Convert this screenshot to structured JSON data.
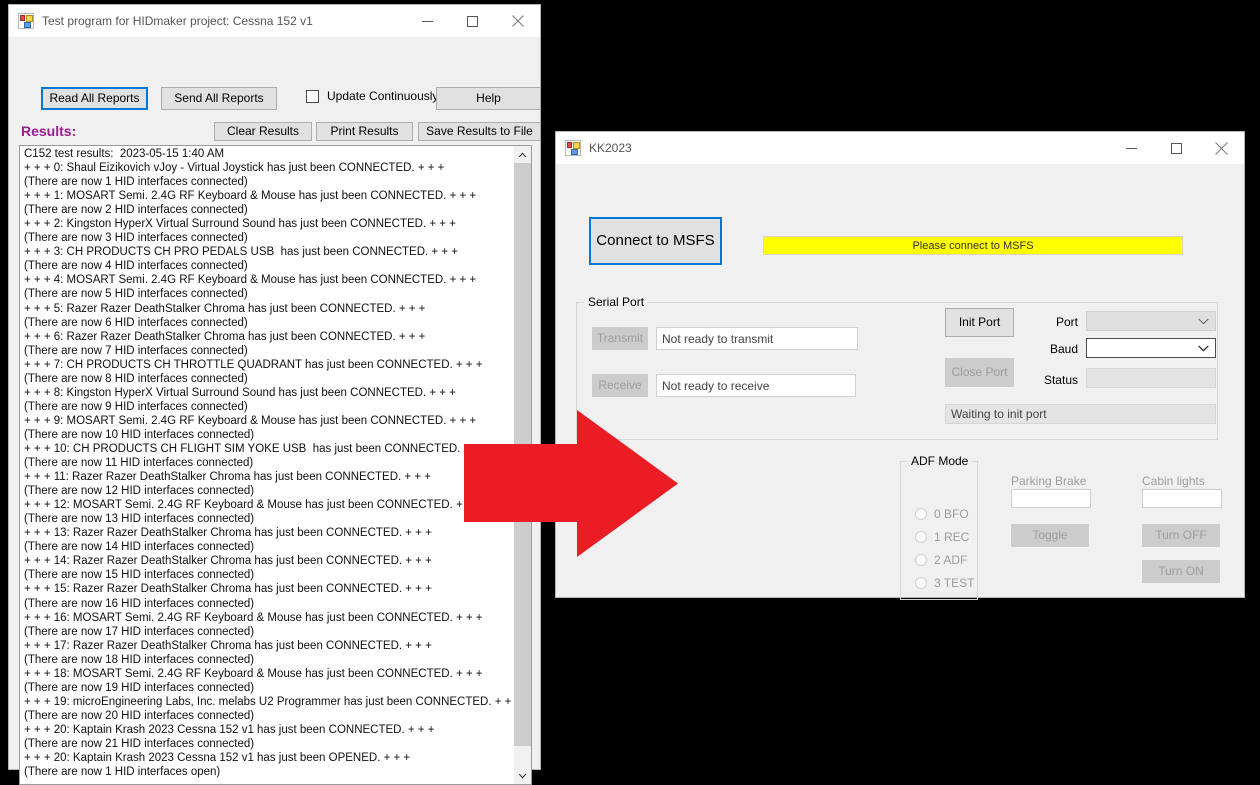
{
  "window_hidmaker": {
    "title": "Test program for HIDmaker project: Cessna 152 v1",
    "icon": "vb-form-icon",
    "caption": {
      "minimize": "minimize-icon",
      "maximize": "maximize-icon",
      "close": "close-icon"
    },
    "toolbar": {
      "read_all_reports": "Read All Reports",
      "send_all_reports": "Send All Reports",
      "update_continuously": "Update Continuously",
      "update_continuously_checked": false,
      "help": "Help",
      "clear_results": "Clear Results",
      "print_results": "Print Results",
      "save_results_to_file": "Save Results to File"
    },
    "results_label": "Results:",
    "results_label_color": "#9b1c8f",
    "results_text": "C152 test results:  2023-05-15 1:40 AM\n+ + + 0: Shaul Eizikovich vJoy - Virtual Joystick has just been CONNECTED. + + +\n(There are now 1 HID interfaces connected)\n+ + + 1: MOSART Semi. 2.4G RF Keyboard & Mouse has just been CONNECTED. + + +\n(There are now 2 HID interfaces connected)\n+ + + 2: Kingston HyperX Virtual Surround Sound has just been CONNECTED. + + +\n(There are now 3 HID interfaces connected)\n+ + + 3: CH PRODUCTS CH PRO PEDALS USB  has just been CONNECTED. + + +\n(There are now 4 HID interfaces connected)\n+ + + 4: MOSART Semi. 2.4G RF Keyboard & Mouse has just been CONNECTED. + + +\n(There are now 5 HID interfaces connected)\n+ + + 5: Razer Razer DeathStalker Chroma has just been CONNECTED. + + +\n(There are now 6 HID interfaces connected)\n+ + + 6: Razer Razer DeathStalker Chroma has just been CONNECTED. + + +\n(There are now 7 HID interfaces connected)\n+ + + 7: CH PRODUCTS CH THROTTLE QUADRANT has just been CONNECTED. + + +\n(There are now 8 HID interfaces connected)\n+ + + 8: Kingston HyperX Virtual Surround Sound has just been CONNECTED. + + +\n(There are now 9 HID interfaces connected)\n+ + + 9: MOSART Semi. 2.4G RF Keyboard & Mouse has just been CONNECTED. + + +\n(There are now 10 HID interfaces connected)\n+ + + 10: CH PRODUCTS CH FLIGHT SIM YOKE USB  has just been CONNECTED. + + +\n(There are now 11 HID interfaces connected)\n+ + + 11: Razer Razer DeathStalker Chroma has just been CONNECTED. + + +\n(There are now 12 HID interfaces connected)\n+ + + 12: MOSART Semi. 2.4G RF Keyboard & Mouse has just been CONNECTED. + + +\n(There are now 13 HID interfaces connected)\n+ + + 13: Razer Razer DeathStalker Chroma has just been CONNECTED. + + +\n(There are now 14 HID interfaces connected)\n+ + + 14: Razer Razer DeathStalker Chroma has just been CONNECTED. + + +\n(There are now 15 HID interfaces connected)\n+ + + 15: Razer Razer DeathStalker Chroma has just been CONNECTED. + + +\n(There are now 16 HID interfaces connected)\n+ + + 16: MOSART Semi. 2.4G RF Keyboard & Mouse has just been CONNECTED. + + +\n(There are now 17 HID interfaces connected)\n+ + + 17: Razer Razer DeathStalker Chroma has just been CONNECTED. + + +\n(There are now 18 HID interfaces connected)\n+ + + 18: MOSART Semi. 2.4G RF Keyboard & Mouse has just been CONNECTED. + + +\n(There are now 19 HID interfaces connected)\n+ + + 19: microEngineering Labs, Inc. melabs U2 Programmer has just been CONNECTED. + + +\n(There are now 20 HID interfaces connected)\n+ + + 20: Kaptain Krash 2023 Cessna 152 v1 has just been CONNECTED. + + +\n(There are now 21 HID interfaces connected)\n+ + + 20: Kaptain Krash 2023 Cessna 152 v1 has just been OPENED. + + +\n(There are now 1 HID interfaces open)"
  },
  "window_kk2023": {
    "title": "KK2023",
    "icon": "vb-form-icon",
    "caption": {
      "minimize": "minimize-icon",
      "maximize": "maximize-icon",
      "close": "close-icon"
    },
    "connect_button": "Connect to MSFS",
    "connect_status": "Please connect to MSFS",
    "connect_status_bg": "#ffff00",
    "serial_port": {
      "group_title": "Serial Port",
      "transmit_button": "Transmit",
      "transmit_value": "Not ready to transmit",
      "receive_button": "Receive",
      "receive_value": "Not ready to receive",
      "init_port_button": "Init Port",
      "close_port_button": "Close Port",
      "port_label": "Port",
      "port_value": "",
      "baud_label": "Baud",
      "baud_value": "",
      "status_label": "Status",
      "status_value": "",
      "waiting_value": "Waiting to init port"
    },
    "adf": {
      "group_title": "ADF Mode",
      "options": [
        "0 BFO",
        "1 REC",
        "2 ADF",
        "3 TEST"
      ],
      "selected": null
    },
    "parking_brake": {
      "label": "Parking Brake",
      "value": "",
      "toggle_button": "Toggle"
    },
    "cabin_lights": {
      "label": "Cabin lights",
      "value": "",
      "turn_off_button": "Turn OFF",
      "turn_on_button": "Turn ON"
    }
  },
  "annotation": {
    "arrow": "red-right-arrow",
    "color": "#ec1c24"
  }
}
